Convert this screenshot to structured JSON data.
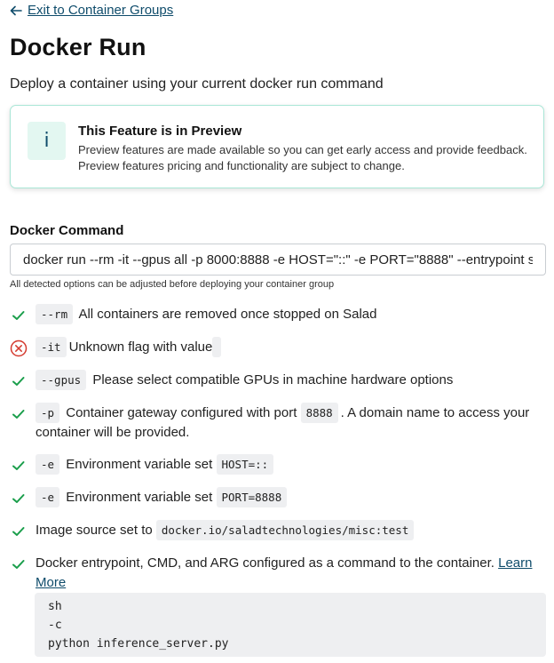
{
  "nav": {
    "back_label": "Exit to Container Groups"
  },
  "page": {
    "title": "Docker Run",
    "subtitle": "Deploy a container using your current docker run command"
  },
  "notice": {
    "icon": "info-icon",
    "icon_glyph": "i",
    "title": "This Feature is in Preview",
    "body": "Preview features are made available so you can get early access and provide feedback. Preview features pricing and functionality are subject to change."
  },
  "command": {
    "label": "Docker Command",
    "value": "docker run --rm -it --gpus all -p 8000:8888 -e HOST=\"::\" -e PORT=\"8888\" --entrypoint sh docker.io/saladtechnologies/misc:test -c \"python inference_server.py\"",
    "hint": "All detected options can be adjusted before deploying your container group"
  },
  "options": [
    {
      "status": "ok",
      "flag": "--rm",
      "text": "All containers are removed once stopped on Salad"
    },
    {
      "status": "error",
      "flag": "-it",
      "text": "Unknown flag with value",
      "value": ""
    },
    {
      "status": "ok",
      "flag": "--gpus",
      "text": "Please select compatible GPUs in machine hardware options"
    },
    {
      "status": "ok",
      "flag": "-p",
      "text_before": "Container gateway configured with port",
      "value": "8888",
      "text_after": ". A domain name to access your container will be provided."
    },
    {
      "status": "ok",
      "flag": "-e",
      "text": "Environment variable set",
      "value": "HOST=::"
    },
    {
      "status": "ok",
      "flag": "-e",
      "text": "Environment variable set",
      "value": "PORT=8888"
    },
    {
      "status": "ok",
      "text": "Image source set to",
      "value": "docker.io/saladtechnologies/misc:test"
    },
    {
      "status": "ok",
      "text": "Docker entrypoint, CMD, and ARG configured as a command to the container.",
      "link": "Learn More"
    }
  ],
  "entrypoint_lines": [
    "sh",
    "-c",
    "python inference_server.py"
  ],
  "colors": {
    "ok": "#1a9e4b",
    "error": "#d43a2f",
    "link": "#0f4c6b",
    "accent_border": "#a9e6d6"
  }
}
